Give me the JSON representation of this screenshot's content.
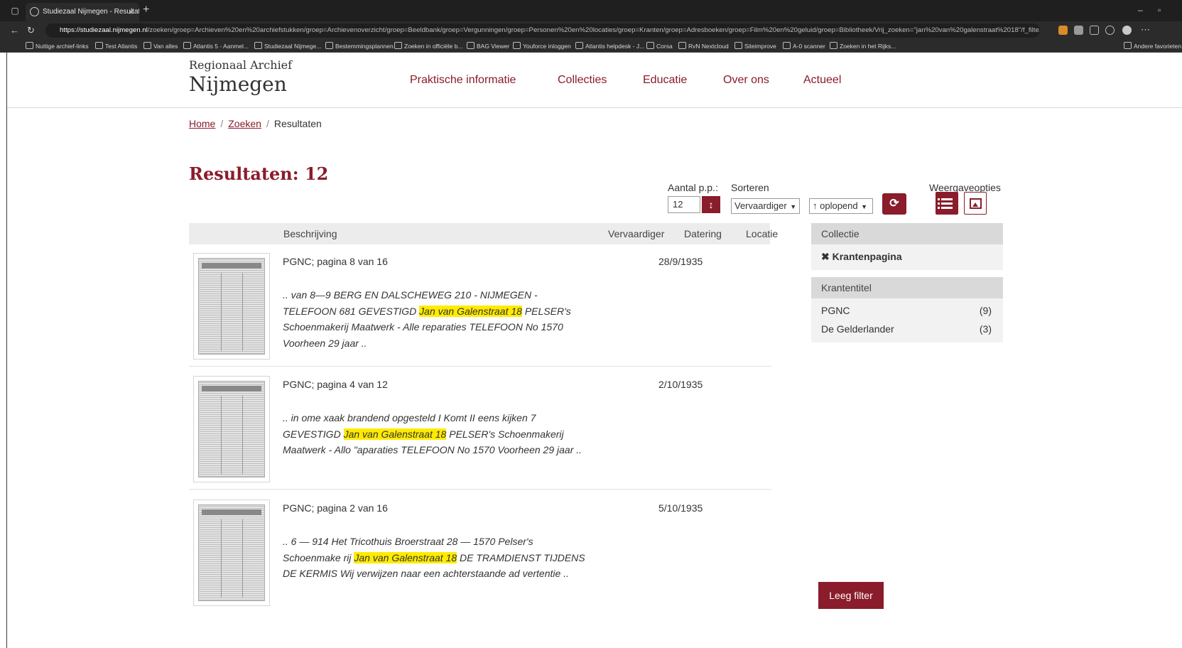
{
  "browser": {
    "tab_title": "Studiezaal Nijmegen - Resultaten",
    "url_host": "https://studiezaal.nijmegen.nl",
    "url_path": "/zoeken/groep=Archieven%20en%20archiefstukken/groep=Archievenoverzicht/groep=Beeldbank/groep=Vergunningen/groep=Personen%20en%20locaties/groep=Kranten/groep=Adresboeken/groep=Film%20en%20geluid/groep=Bibliotheek/Vrij_zoeken=\"jan%20van%20galenstraat%2018\"/f_filte...",
    "bookmarks": [
      "Nuttige archief-links",
      "Test Atlantis",
      "Van alles",
      "Atlantis 5 - Aanmel...",
      "Studiezaal Nijmege...",
      "Bestemmingsplannen",
      "Zoeken in officiële b...",
      "BAG Viewer",
      "Youforce inloggen",
      "Atlantis helpdesk - J...",
      "Corsa",
      "RvN Nextcloud",
      "Siteimprove",
      "A-0 scanner",
      "Zoeken in het Rijks..."
    ],
    "other_bookmarks": "Andere favorieten"
  },
  "site": {
    "logo_top": "Regionaal Archief",
    "logo_main": "Nijmegen",
    "nav": [
      "Praktische informatie",
      "Collecties",
      "Educatie",
      "Over ons",
      "Actueel"
    ]
  },
  "breadcrumb": {
    "home": "Home",
    "zoeken": "Zoeken",
    "current": "Resultaten",
    "sep": "/"
  },
  "results": {
    "title": "Resultaten: 12"
  },
  "controls": {
    "per_page_label": "Aantal p.p.:",
    "per_page_value": "12",
    "per_page_btn": "↕",
    "sort_label": "Sorteren",
    "sort_value": "Vervaardiger",
    "order_value": "↑ oplopend",
    "refresh_icon": "⟳",
    "view_label": "Weergaveopties"
  },
  "table": {
    "col_beschrijving": "Beschrijving",
    "col_vervaardiger": "Vervaardiger",
    "col_datering": "Datering",
    "col_locatie": "Locatie"
  },
  "items": [
    {
      "title": "PGNC; pagina 8 van 16",
      "date": "28/9/1935",
      "snippet_before": ".. van 8—9 BERG EN DALSCHEWEG 210 - NIJMEGEN - TELEFOON 681 GEVESTIGD ",
      "highlight": "Jan van Galenstraat 18",
      "snippet_after": " PELSER's Schoenmakerij Maatwerk - Alle reparaties TELEFOON No 1570 Voorheen 29 jaar .."
    },
    {
      "title": "PGNC; pagina 4 van 12",
      "date": "2/10/1935",
      "snippet_before": ".. in ome xaak brandend opgesteld I Komt II eens kijken 7 GEVESTIGD ",
      "highlight": "Jan van Galenstraat 18",
      "snippet_after": " PELSER's Schoenmakerij Maatwerk - Allo \"aparaties TELEFOON No 1570 Voorheen 29 jaar .."
    },
    {
      "title": "PGNC; pagina 2 van 16",
      "date": "5/10/1935",
      "snippet_before": ".. 6 — 914 Het Tricothuis Broerstraat 28 — 1570 Pelser's Schoenmake rij ",
      "highlight": "Jan van Galenstraat 18",
      "snippet_after": " DE TRAMDIENST TIJDENS DE KERMIS Wij verwijzen naar een achterstaande ad vertentie .."
    }
  ],
  "facets": {
    "collectie_head": "Collectie",
    "collectie_active": "✖ Krantenpagina",
    "krantentitel_head": "Krantentitel",
    "krantentitel": [
      {
        "label": "PGNC",
        "count": "(9)"
      },
      {
        "label": "De Gelderlander",
        "count": "(3)"
      }
    ]
  },
  "filter_button": "Leeg filter",
  "colors": {
    "brand": "#8a1c2b",
    "highlight": "#ffeb00"
  }
}
